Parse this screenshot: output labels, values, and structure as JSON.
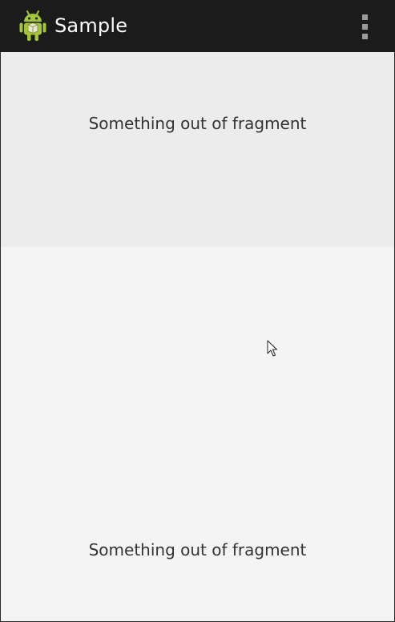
{
  "action_bar": {
    "title": "Sample",
    "app_icon": "android-robot-icon",
    "overflow_icon": "overflow-menu-icon",
    "background": "#1b1b1b"
  },
  "fragments": {
    "top": {
      "text": "Something out of fragment",
      "background": "#ececec"
    },
    "bottom": {
      "text": "Something out of fragment",
      "background": "#f4f4f4"
    }
  },
  "cursor_icon": "mouse-pointer-icon"
}
